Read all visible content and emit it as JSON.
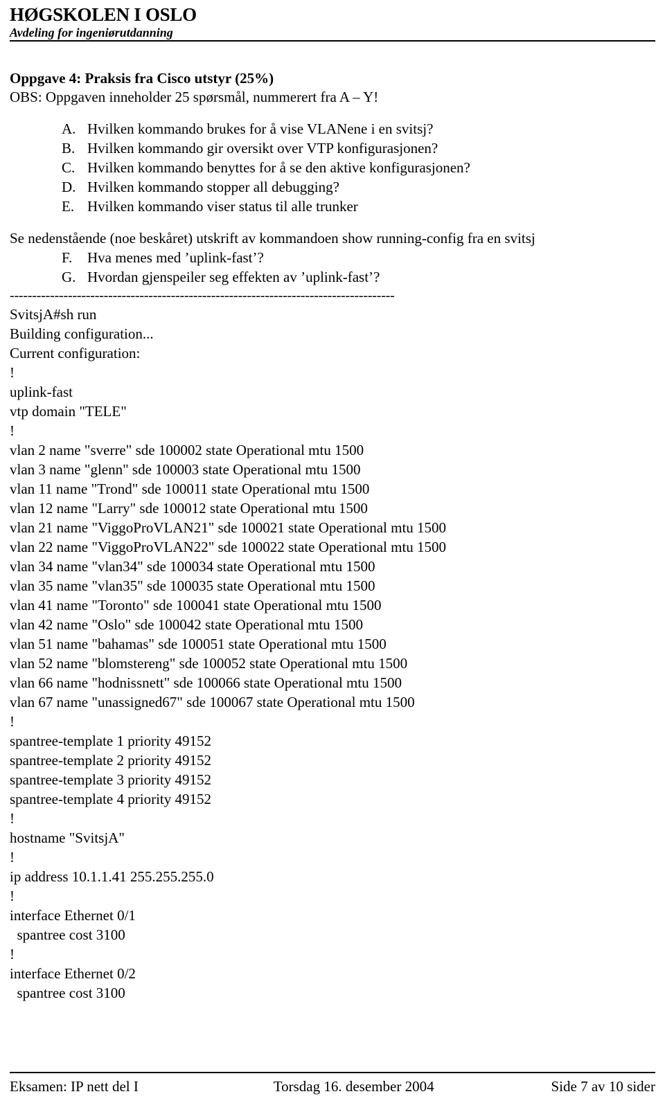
{
  "letterhead": {
    "institution": "HØGSKOLEN I OSLO",
    "department": "Avdeling for ingeniørutdanning"
  },
  "task": {
    "title": "Oppgave 4: Praksis fra Cisco utstyr (25%)",
    "obs": "OBS: Oppgaven inneholder 25 spørsmål, nummerert fra A – Y!"
  },
  "questions_first": [
    {
      "letter": "A.",
      "text": "Hvilken kommando brukes for å vise VLANene i en svitsj?"
    },
    {
      "letter": "B.",
      "text": "Hvilken kommando gir oversikt over VTP konfigurasjonen?"
    },
    {
      "letter": "C.",
      "text": "Hvilken kommando benyttes for å se den aktive konfigurasjonen?"
    },
    {
      "letter": "D.",
      "text": "Hvilken kommando stopper all debugging?"
    },
    {
      "letter": "E.",
      "text": "Hvilken kommando viser status til alle trunker"
    }
  ],
  "note": "Se nedenstående (noe beskåret) utskrift av kommandoen show running-config fra en svitsj",
  "questions_second": [
    {
      "letter": "F.",
      "text": "Hva menes med ’uplink-fast’?"
    },
    {
      "letter": "G.",
      "text": "Hvordan gjenspeiler seg effekten av ’uplink-fast’?"
    }
  ],
  "separator": "--------------------------------------------------------------------------------------",
  "terminal": {
    "lines": [
      "SvitsjA#sh run",
      "Building configuration...",
      "Current configuration:",
      "!",
      "uplink-fast",
      "vtp domain \"TELE\"",
      "!",
      "vlan 2 name \"sverre\" sde 100002 state Operational mtu 1500",
      "vlan 3 name \"glenn\" sde 100003 state Operational mtu 1500",
      "vlan 11 name \"Trond\" sde 100011 state Operational mtu 1500",
      "vlan 12 name \"Larry\" sde 100012 state Operational mtu 1500",
      "vlan 21 name \"ViggoProVLAN21\" sde 100021 state Operational mtu 1500",
      "vlan 22 name \"ViggoProVLAN22\" sde 100022 state Operational mtu 1500",
      "vlan 34 name \"vlan34\" sde 100034 state Operational mtu 1500",
      "vlan 35 name \"vlan35\" sde 100035 state Operational mtu 1500",
      "vlan 41 name \"Toronto\" sde 100041 state Operational mtu 1500",
      "vlan 42 name \"Oslo\" sde 100042 state Operational mtu 1500",
      "vlan 51 name \"bahamas\" sde 100051 state Operational mtu 1500",
      "vlan 52 name \"blomstereng\" sde 100052 state Operational mtu 1500",
      "vlan 66 name \"hodnissnett\" sde 100066 state Operational mtu 1500",
      "vlan 67 name \"unassigned67\" sde 100067 state Operational mtu 1500",
      "!",
      "spantree-template 1 priority 49152",
      "spantree-template 2 priority 49152",
      "spantree-template 3 priority 49152",
      "spantree-template 4 priority 49152",
      "!",
      "hostname \"SvitsjA\"",
      "!",
      "ip address 10.1.1.41 255.255.255.0",
      "!",
      "interface Ethernet 0/1",
      "  spantree cost 3100",
      "!",
      "interface Ethernet 0/2",
      "  spantree cost 3100"
    ]
  },
  "footer": {
    "left": "Eksamen: IP nett del I",
    "center": "Torsdag 16. desember 2004",
    "right": "Side 7 av 10 sider"
  }
}
